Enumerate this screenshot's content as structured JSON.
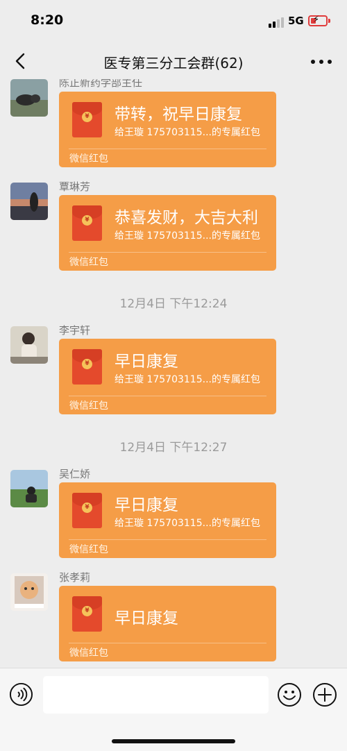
{
  "status_bar": {
    "time": "8:20",
    "network": "5G"
  },
  "nav": {
    "title": "医专第三分工会群(62)"
  },
  "messages": [
    {
      "sender": "陈正新药学部主任",
      "title": "带转，祝早日康复",
      "subtitle": "给王璇 175703115...的专属红包",
      "footer": "微信红包"
    },
    {
      "sender": "覃琳芳",
      "title": "恭喜发财，大吉大利",
      "subtitle": "给王璇 175703115...的专属红包",
      "footer": "微信红包"
    },
    {
      "sender": "李宇轩",
      "title": "早日康复",
      "subtitle": "给王璇 175703115...的专属红包",
      "footer": "微信红包"
    },
    {
      "sender": "吴仁娇",
      "title": "早日康复",
      "subtitle": "给王璇 175703115...的专属红包",
      "footer": "微信红包"
    },
    {
      "sender": "张孝莉",
      "title": "早日康复",
      "subtitle": "",
      "footer": "微信红包"
    }
  ],
  "timestamps": [
    "12月4日 下午12:24",
    "12月4日 下午12:27"
  ],
  "packet_coin": "¥",
  "input": {
    "value": "",
    "placeholder": ""
  },
  "colors": {
    "packet": "#f59d47",
    "packet_icon": "#e44a2c",
    "background": "#ededed"
  }
}
